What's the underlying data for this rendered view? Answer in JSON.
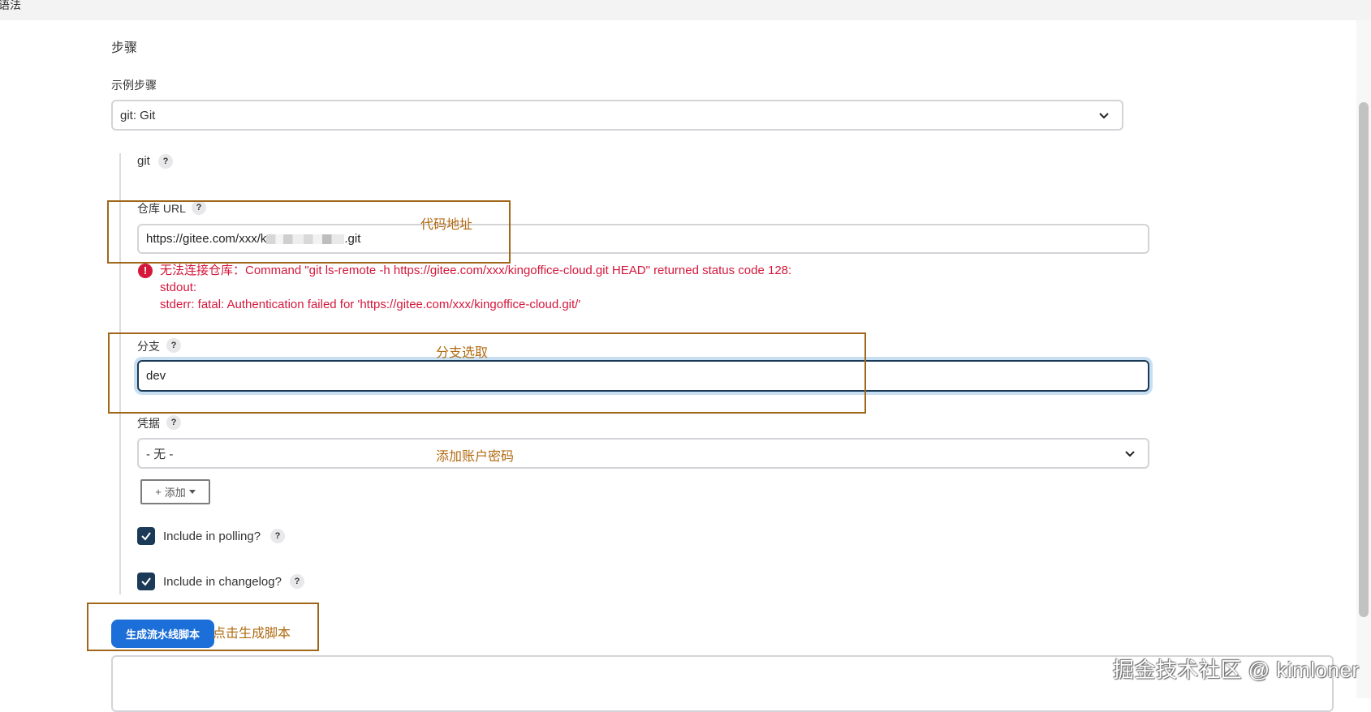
{
  "header": {
    "partial_label": "语法"
  },
  "steps": {
    "section_title": "步骤",
    "sample_step_label": "示例步骤",
    "sample_step_value": "git: Git"
  },
  "git": {
    "title": "git",
    "help": "?",
    "repo_url": {
      "label": "仓库 URL",
      "value_prefix": "https://gitee.com/xxx/k",
      "value_suffix": ".git"
    },
    "error": {
      "icon": "!",
      "line1": "无法连接仓库：Command \"git ls-remote -h https://gitee.com/xxx/kingoffice-cloud.git HEAD\" returned status code 128:",
      "line2": "stdout:",
      "line3": "stderr: fatal: Authentication failed for 'https://gitee.com/xxx/kingoffice-cloud.git/'"
    },
    "branch": {
      "label": "分支",
      "value": "dev"
    },
    "credentials": {
      "label": "凭据",
      "value": "- 无 -"
    },
    "add_button": {
      "label": "添加",
      "prefix": "+"
    },
    "include_polling": {
      "label": "Include in polling?",
      "checked": true
    },
    "include_changelog": {
      "label": "Include in changelog?",
      "checked": true
    }
  },
  "annotations": {
    "repo": "代码地址",
    "branch": "分支选取",
    "credentials": "添加账户密码",
    "generate": "点击生成脚本"
  },
  "generate_button": {
    "label": "生成流水线脚本"
  },
  "watermark": "掘金技术社区 @ kimloner",
  "colors": {
    "error": "#d4173b",
    "primary_button": "#1c6fd8",
    "checkbox": "#1b3a57",
    "annotation": "#a0671a"
  }
}
